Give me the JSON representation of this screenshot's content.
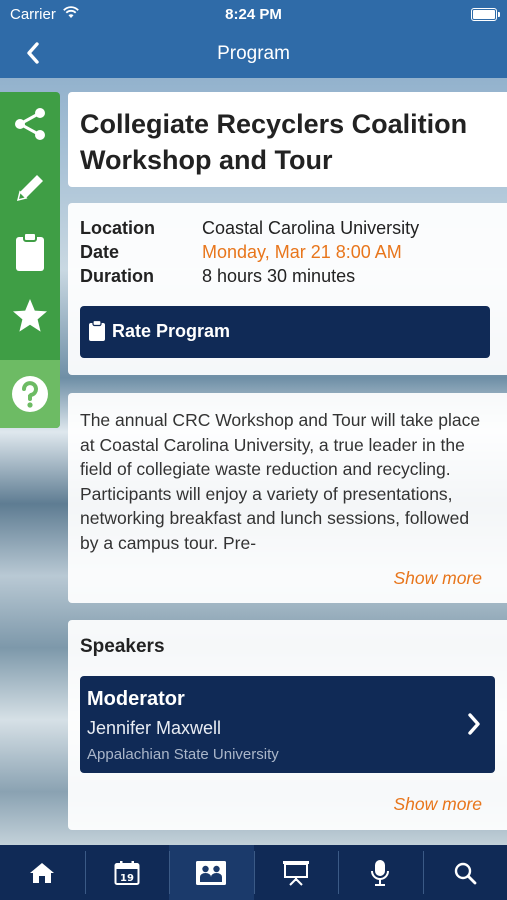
{
  "status_bar": {
    "carrier": "Carrier",
    "time": "8:24 PM"
  },
  "nav": {
    "title": "Program"
  },
  "side_actions": [
    "share-icon",
    "pencil-icon",
    "clipboard-icon",
    "star-icon",
    "help-icon"
  ],
  "program": {
    "title": "Collegiate Recyclers Coalition Workshop and Tour",
    "location_label": "Location",
    "location": "Coastal Carolina University",
    "date_label": "Date",
    "date": "Monday, Mar 21 8:00 AM",
    "duration_label": "Duration",
    "duration": "8 hours 30 minutes",
    "rate_button": "Rate Program",
    "description": "The annual CRC Workshop and Tour will take place at Coastal Carolina University, a true leader in the field of collegiate waste reduction and recycling. Participants will enjoy a variety of presentations, networking breakfast and lunch sessions, followed by a campus tour. Pre-",
    "show_more": "Show more"
  },
  "speakers": {
    "heading": "Speakers",
    "items": [
      {
        "role": "Moderator",
        "name": "Jennifer Maxwell",
        "org": "Appalachian State University"
      }
    ],
    "show_more": "Show more"
  },
  "tab_bar": {
    "tabs": [
      "home-icon",
      "calendar-icon",
      "attendees-icon",
      "presentation-icon",
      "microphone-icon",
      "search-icon"
    ],
    "calendar_day": "19",
    "active_index": 2
  },
  "colors": {
    "nav_blue": "#2f6ba8",
    "dark_navy": "#102a56",
    "green": "#3f9e45",
    "accent_orange": "#e8761c"
  }
}
